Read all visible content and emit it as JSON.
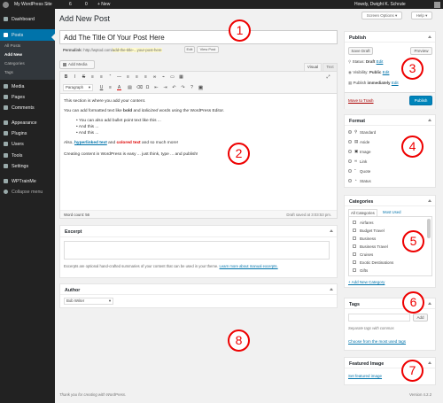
{
  "admin_bar": {
    "site": "My WordPress Site",
    "updates": "6",
    "comments": "0",
    "new": "+ New",
    "howdy": "Howdy, Dwight K. Schrute"
  },
  "sidebar": {
    "items": [
      {
        "label": "Dashboard"
      },
      {
        "label": "Posts"
      },
      {
        "label": "Media"
      },
      {
        "label": "Pages"
      },
      {
        "label": "Comments"
      },
      {
        "label": "Appearance"
      },
      {
        "label": "Plugins"
      },
      {
        "label": "Users"
      },
      {
        "label": "Tools"
      },
      {
        "label": "Settings"
      },
      {
        "label": "WPTrainMe"
      },
      {
        "label": "Collapse menu"
      }
    ],
    "posts_sub": [
      "All Posts",
      "Add New",
      "Categories",
      "Tags"
    ]
  },
  "page": {
    "title": "Add New Post",
    "screen_options": "Screen Options ▾",
    "help": "Help ▾",
    "footer_left": "Thank you for creating with WordPress.",
    "footer_link": "WordPress",
    "version": "Version 4.2.2"
  },
  "editor": {
    "title_value": "Add The Title Of Your Post Here",
    "permalink_label": "Permalink:",
    "permalink_base": "http://wptod.com/",
    "permalink_slug": "add-the-title-...your-post-here",
    "edit_btn": "Edit",
    "view_btn": "View Post",
    "add_media": "Add Media",
    "tab_visual": "Visual",
    "tab_text": "Text",
    "format_select": "Paragraph",
    "content": {
      "p1": "This section is where you add your content.",
      "p2a": "You can add formatted text like ",
      "p2_bold": "bold",
      "p2b": " and ",
      "p2_italic": "italicized",
      "p2c": " words using the WordPress Editor.",
      "bullets": [
        "You can also add bullet point text like this ...",
        "And this ...",
        "And this ..."
      ],
      "p3a": "Also, ",
      "p3_link": "hyperlinked text",
      "p3b": " and ",
      "p3_colored": "colored text",
      "p3c": " and so much more!",
      "p4": "Creating content in WordPress is easy ... just think, type ... and publish!"
    },
    "word_count": "Word count: 56",
    "draft_saved": "Draft saved at 3:03:53 pm."
  },
  "excerpt": {
    "title": "Excerpt",
    "help": "Excerpts are optional hand-crafted summaries of your content that can be used in your theme. ",
    "help_link": "Learn more about manual excerpts."
  },
  "author": {
    "title": "Author",
    "value": "Bob Writer"
  },
  "publish": {
    "title": "Publish",
    "save_draft": "Save Draft",
    "preview": "Preview",
    "status_label": "Status: ",
    "status_value": "Draft",
    "visibility_label": "Visibility: ",
    "visibility_value": "Public",
    "publish_label": "Publish ",
    "publish_value": "immediately",
    "edit": "Edit",
    "trash": "Move to Trash",
    "publish_btn": "Publish"
  },
  "format": {
    "title": "Format",
    "options": [
      "Standard",
      "Aside",
      "Image",
      "Link",
      "Quote",
      "Status"
    ],
    "selected": "Standard"
  },
  "categories": {
    "title": "Categories",
    "tab_all": "All Categories",
    "tab_used": "Most Used",
    "items": [
      "Airfares",
      "Budget Travel",
      "Business",
      "Business Travel",
      "Cruises",
      "Exotic Destinations",
      "Gifts"
    ],
    "add": "+ Add New Category"
  },
  "tags": {
    "title": "Tags",
    "add_btn": "Add",
    "help": "Separate tags with commas",
    "choose": "Choose from the most used tags"
  },
  "featured": {
    "title": "Featured Image",
    "set": "Set featured image"
  },
  "callouts": [
    "1",
    "2",
    "3",
    "4",
    "5",
    "6",
    "7",
    "8"
  ],
  "colors": {
    "admin_bar": "#222222",
    "sidebar": "#222222",
    "active": "#0073aa",
    "callout": "#ee0000",
    "link": "#0073aa",
    "colored_text": "#dd0000"
  }
}
